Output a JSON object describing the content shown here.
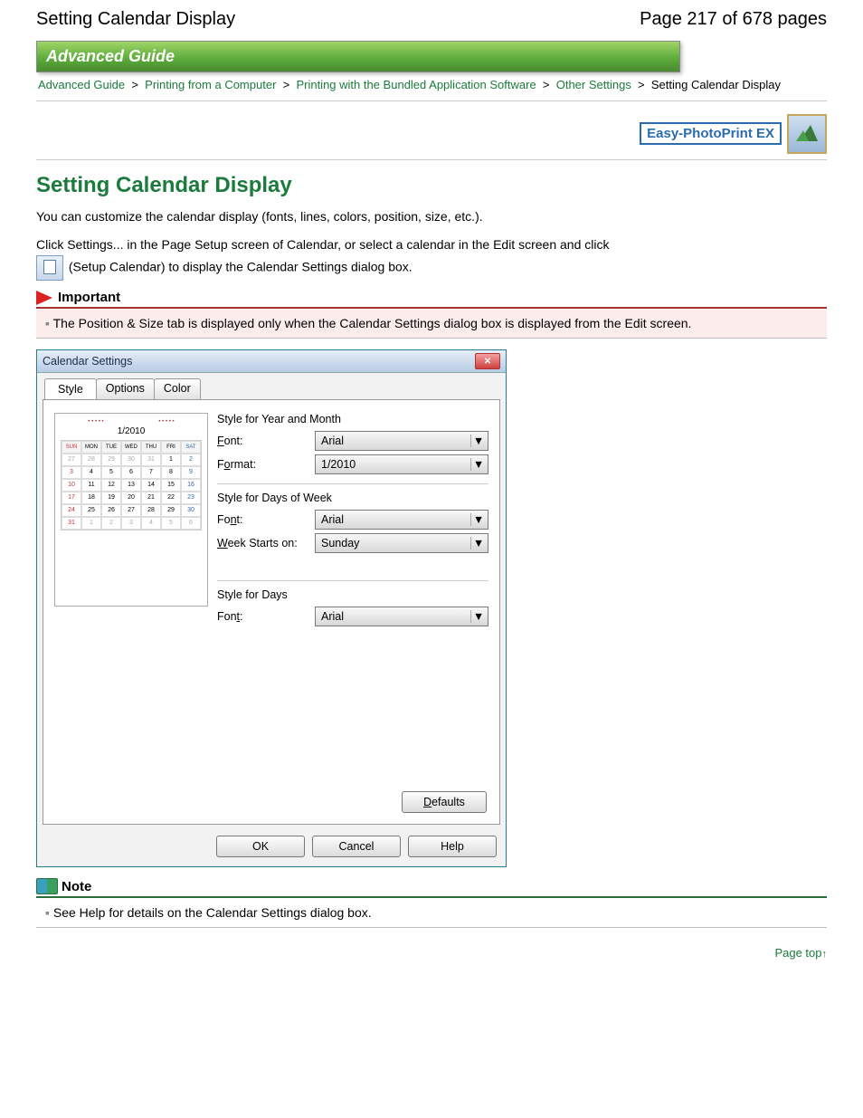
{
  "header": {
    "title": "Setting Calendar Display",
    "pager": "Page 217 of 678 pages"
  },
  "banner": "Advanced Guide",
  "breadcrumb": {
    "items": [
      "Advanced Guide",
      "Printing from a Computer",
      "Printing with the Bundled Application Software",
      "Other Settings"
    ],
    "current": "Setting Calendar Display"
  },
  "badge": {
    "label": "Easy-PhotoPrint EX"
  },
  "main_heading": "Setting Calendar Display",
  "intro": "You can customize the calendar display (fonts, lines, colors, position, size, etc.).",
  "howto_line1": "Click Settings... in the Page Setup screen of Calendar, or select a calendar in the Edit screen and click",
  "howto_line2": "(Setup Calendar) to display the Calendar Settings dialog box.",
  "important": {
    "title": "Important",
    "text": "The Position & Size tab is displayed only when the Calendar Settings dialog box is displayed from the Edit screen."
  },
  "dialog": {
    "title": "Calendar Settings",
    "tabs": [
      "Style",
      "Options",
      "Color"
    ],
    "active_tab": "Style",
    "preview": {
      "label": "1/2010",
      "days_header": [
        "SUN",
        "MON",
        "TUE",
        "WED",
        "THU",
        "FRI",
        "SAT"
      ],
      "grid": [
        [
          "27",
          "28",
          "29",
          "30",
          "31",
          "1",
          "2"
        ],
        [
          "3",
          "4",
          "5",
          "6",
          "7",
          "8",
          "9"
        ],
        [
          "10",
          "11",
          "12",
          "13",
          "14",
          "15",
          "16"
        ],
        [
          "17",
          "18",
          "19",
          "20",
          "21",
          "22",
          "23"
        ],
        [
          "24",
          "25",
          "26",
          "27",
          "28",
          "29",
          "30"
        ],
        [
          "31",
          "1",
          "2",
          "3",
          "4",
          "5",
          "6"
        ]
      ]
    },
    "sections": {
      "year_month": {
        "title": "Style for Year and Month",
        "font_label": "Font:",
        "font_value": "Arial",
        "format_label": "Format:",
        "format_value": "1/2010"
      },
      "days_week": {
        "title": "Style for Days of Week",
        "font_label": "Font:",
        "font_value": "Arial",
        "week_label": "Week Starts on:",
        "week_value": "Sunday"
      },
      "days": {
        "title": "Style for Days",
        "font_label": "Font:",
        "font_value": "Arial"
      }
    },
    "defaults_button": "Defaults",
    "actions": {
      "ok": "OK",
      "cancel": "Cancel",
      "help": "Help"
    }
  },
  "note": {
    "title": "Note",
    "text": "See Help for details on the Calendar Settings dialog box."
  },
  "page_top": "Page top"
}
